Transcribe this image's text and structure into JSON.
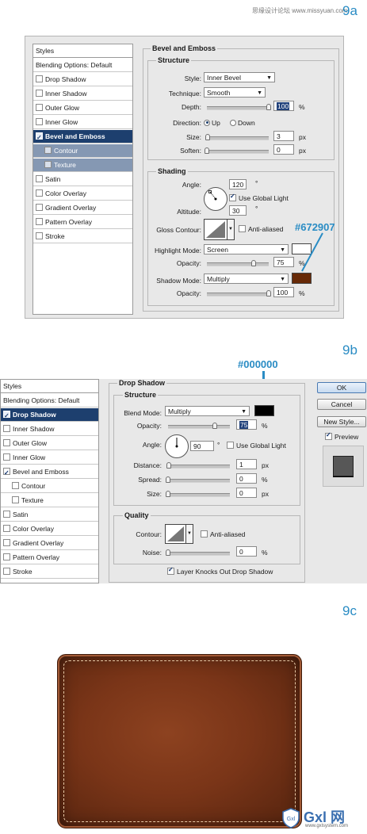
{
  "watermark": "思缘设计论坛 www.missyuan.com",
  "steps": {
    "a": "9a",
    "b": "9b",
    "c": "9c"
  },
  "annotations": {
    "highlight_color_label": "#672907",
    "drop_color_label": "#000000"
  },
  "colors": {
    "accent": "#2a8cc4",
    "shadow_swatch": "#672907",
    "highlight_swatch": "#ffffff",
    "drop_swatch": "#000000",
    "leather": "#7a3518"
  },
  "panel_a": {
    "sidebar": [
      "Styles",
      "Blending Options: Default",
      "Drop Shadow",
      "Inner Shadow",
      "Outer Glow",
      "Inner Glow",
      "Bevel and Emboss",
      "Contour",
      "Texture",
      "Satin",
      "Color Overlay",
      "Gradient Overlay",
      "Pattern Overlay",
      "Stroke"
    ],
    "title": "Bevel and Emboss",
    "structure": {
      "title": "Structure",
      "style_label": "Style:",
      "style_value": "Inner Bevel",
      "technique_label": "Technique:",
      "technique_value": "Smooth",
      "depth_label": "Depth:",
      "depth_value": "100",
      "depth_unit": "%",
      "depth": 1.0,
      "direction_label": "Direction:",
      "up_label": "Up",
      "down_label": "Down",
      "size_label": "Size:",
      "size_value": "3",
      "size_unit": "px",
      "soften_label": "Soften:",
      "soften_value": "0",
      "soften_unit": "px"
    },
    "shading": {
      "title": "Shading",
      "angle_label": "Angle:",
      "angle_value": "120",
      "angle_unit": "°",
      "global_light": "Use Global Light",
      "altitude_label": "Altitude:",
      "altitude_value": "30",
      "altitude_unit": "°",
      "gloss_label": "Gloss Contour:",
      "anti_aliased": "Anti-aliased",
      "highlight_mode_label": "Highlight Mode:",
      "highlight_mode": "Screen",
      "opacity_label": "Opacity:",
      "highlight_opacity": "75",
      "highlight_opacity_frac": 0.75,
      "opacity_unit": "%",
      "shadow_mode_label": "Shadow Mode:",
      "shadow_mode": "Multiply",
      "shadow_opacity": "100",
      "shadow_opacity_frac": 1.0
    }
  },
  "panel_b": {
    "sidebar": [
      "Styles",
      "Blending Options: Default",
      "Drop Shadow",
      "Inner Shadow",
      "Outer Glow",
      "Inner Glow",
      "Bevel and Emboss",
      "Contour",
      "Texture",
      "Satin",
      "Color Overlay",
      "Gradient Overlay",
      "Pattern Overlay",
      "Stroke"
    ],
    "title": "Drop Shadow",
    "structure": {
      "title": "Structure",
      "blend_label": "Blend Mode:",
      "blend_value": "Multiply",
      "opacity_label": "Opacity:",
      "opacity_value": "75",
      "opacity_unit": "%",
      "opacity": 0.75,
      "angle_label": "Angle:",
      "angle_value": "90",
      "angle_unit": "°",
      "global_light": "Use Global Light",
      "distance_label": "Distance:",
      "distance_value": "1",
      "distance_unit": "px",
      "spread_label": "Spread:",
      "spread_value": "0",
      "spread_unit": "%",
      "size_label": "Size:",
      "size_value": "0",
      "size_unit": "px"
    },
    "quality": {
      "title": "Quality",
      "contour_label": "Contour:",
      "anti_aliased": "Anti-aliased",
      "noise_label": "Noise:",
      "noise_value": "0",
      "noise_unit": "%",
      "knockout": "Layer Knocks Out Drop Shadow"
    },
    "buttons": {
      "ok": "OK",
      "cancel": "Cancel",
      "new_style": "New Style...",
      "preview": "Preview"
    }
  },
  "logo": {
    "text": "Gxl 网",
    "url": "www.gxlsystem.com"
  }
}
